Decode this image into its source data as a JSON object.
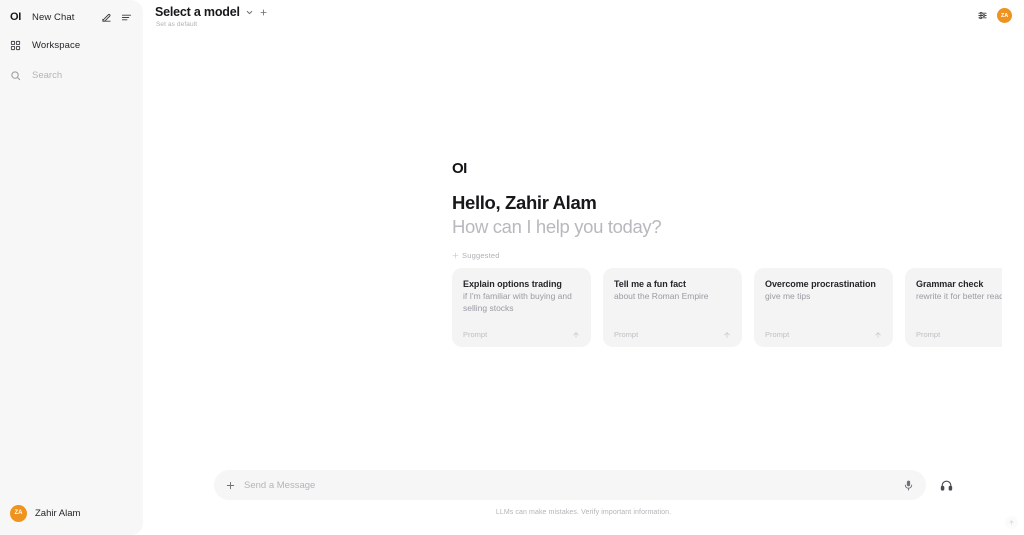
{
  "sidebar": {
    "logo": "OI",
    "new_chat_label": "New Chat",
    "compose_icon": "compose-icon",
    "panel_icon": "panel-toggle-icon",
    "workspace_label": "Workspace",
    "workspace_icon": "grid-icon",
    "search_placeholder": "Search",
    "search_value": "",
    "search_icon": "search-icon",
    "user": {
      "initials": "ZA",
      "name": "Zahir Alam",
      "avatar_color": "#ef9320"
    }
  },
  "topbar": {
    "model_name": "Select a model",
    "chevron_icon": "chevron-down-icon",
    "plus_icon": "plus-icon",
    "set_default_label": "Set as default",
    "settings_icon": "sliders-icon",
    "avatar_initials": "ZA",
    "avatar_color": "#ef9320"
  },
  "hero": {
    "logo": "OI",
    "greeting": "Hello, Zahir Alam",
    "subgreeting": "How can I help you today?",
    "suggested_label": "Suggested",
    "sparkle_icon": "sparkle-icon"
  },
  "cards": [
    {
      "title": "Explain options trading",
      "subtitle": "if I'm familiar with buying and selling stocks",
      "footer": "Prompt",
      "arrow_icon": "arrow-up-icon"
    },
    {
      "title": "Tell me a fun fact",
      "subtitle": "about the Roman Empire",
      "footer": "Prompt",
      "arrow_icon": "arrow-up-icon"
    },
    {
      "title": "Overcome procrastination",
      "subtitle": "give me tips",
      "footer": "Prompt",
      "arrow_icon": "arrow-up-icon"
    },
    {
      "title": "Grammar check",
      "subtitle": "rewrite it for better readability",
      "footer": "Prompt",
      "arrow_icon": "arrow-up-icon"
    }
  ],
  "composer": {
    "attach_icon": "plus-icon",
    "placeholder": "Send a Message",
    "value": "",
    "mic_icon": "microphone-icon",
    "headset_icon": "headphones-icon",
    "disclaimer": "LLMs can make mistakes. Verify important information.",
    "scroll_icon": "arrow-up-icon"
  }
}
